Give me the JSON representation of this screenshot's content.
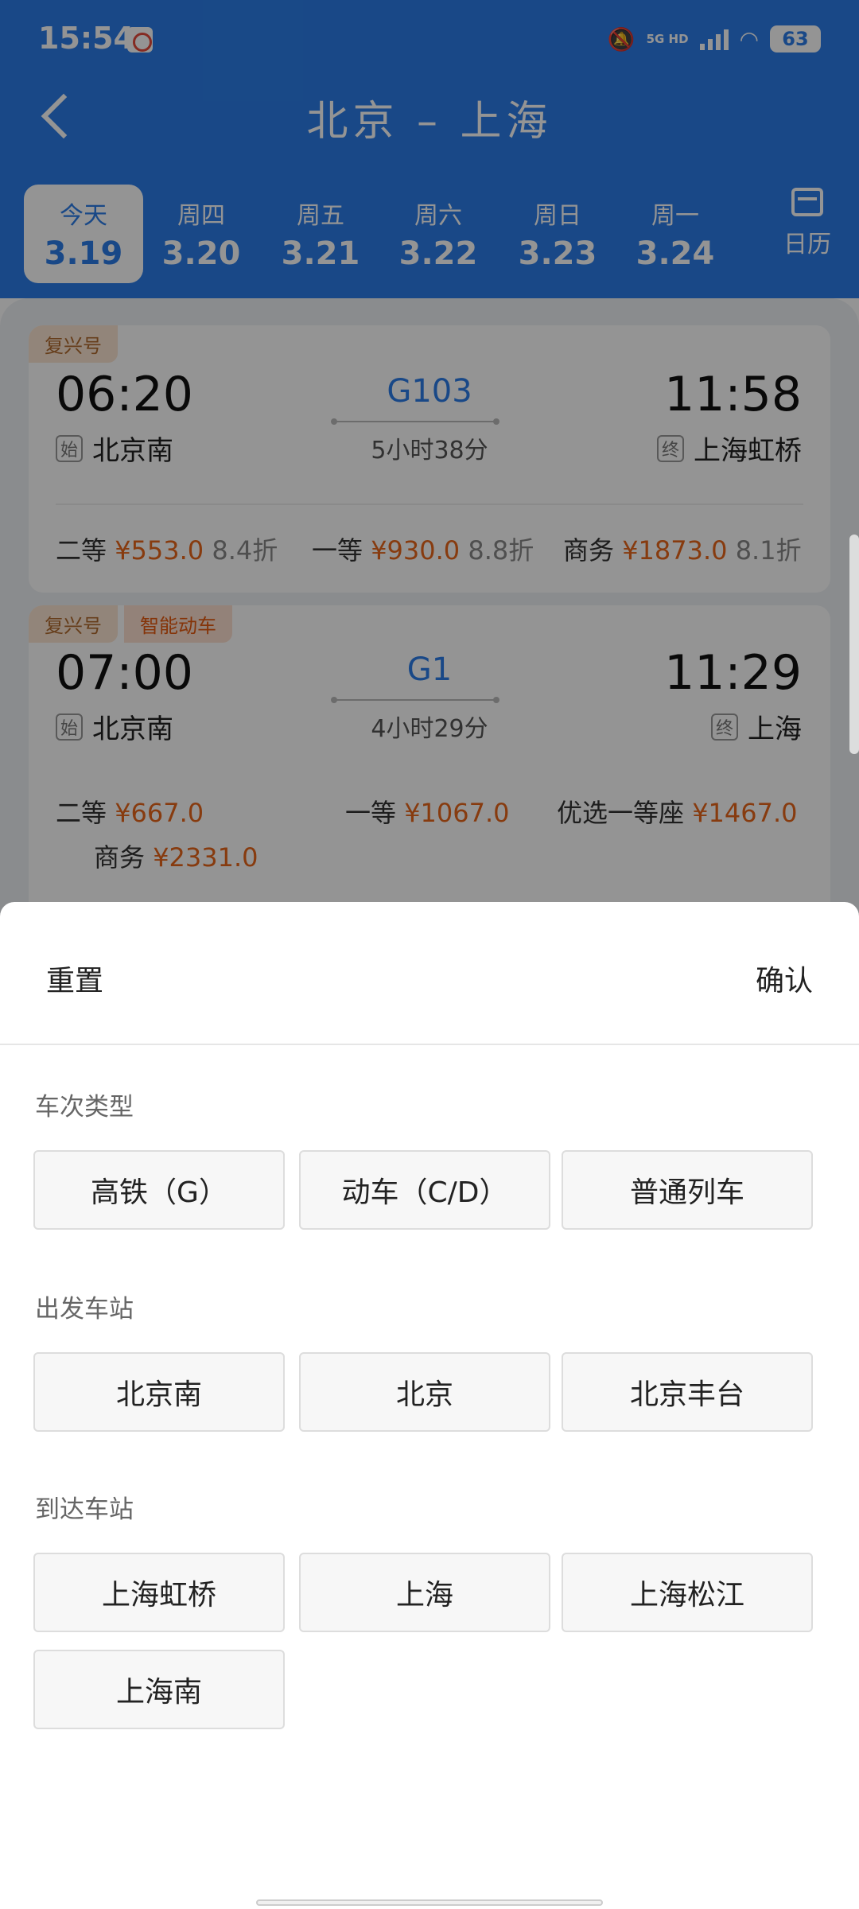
{
  "status_bar": {
    "time": "15:54",
    "network": "5G HD",
    "battery": "63"
  },
  "nav": {
    "title": "北京 – 上海"
  },
  "date_tabs": [
    {
      "weekday": "今天",
      "date": "3.19",
      "active": true
    },
    {
      "weekday": "周四",
      "date": "3.20"
    },
    {
      "weekday": "周五",
      "date": "3.21"
    },
    {
      "weekday": "周六",
      "date": "3.22"
    },
    {
      "weekday": "周日",
      "date": "3.23"
    },
    {
      "weekday": "周一",
      "date": "3.24"
    }
  ],
  "calendar_label": "日历",
  "trains": [
    {
      "tags": [
        "复兴号"
      ],
      "depart_time": "06:20",
      "arrive_time": "11:58",
      "train_no": "G103",
      "duration": "5小时38分",
      "from_badge": "始",
      "from_station": "北京南",
      "to_badge": "终",
      "to_station": "上海虹桥",
      "prices": [
        {
          "seat": "二等",
          "amount": "¥553.0",
          "discount": "8.4折"
        },
        {
          "seat": "一等",
          "amount": "¥930.0",
          "discount": "8.8折"
        },
        {
          "seat": "商务",
          "amount": "¥1873.0",
          "discount": "8.1折"
        }
      ]
    },
    {
      "tags": [
        "复兴号",
        "智能动车"
      ],
      "depart_time": "07:00",
      "arrive_time": "11:29",
      "train_no": "G1",
      "duration": "4小时29分",
      "from_badge": "始",
      "from_station": "北京南",
      "to_badge": "终",
      "to_station": "上海",
      "prices": [
        {
          "seat": "二等",
          "amount": "¥667.0"
        },
        {
          "seat": "一等",
          "amount": "¥1067.0"
        },
        {
          "seat": "优选一等座",
          "amount": "¥1467.0"
        },
        {
          "seat": "商务",
          "amount": "¥2331.0"
        }
      ]
    }
  ],
  "filter_sheet": {
    "reset_label": "重置",
    "confirm_label": "确认",
    "sections": [
      {
        "title": "车次类型",
        "options": [
          "高铁（G）",
          "动车（C/D）",
          "普通列车"
        ]
      },
      {
        "title": "出发车站",
        "options": [
          "北京南",
          "北京",
          "北京丰台"
        ]
      },
      {
        "title": "到达车站",
        "options": [
          "上海虹桥",
          "上海",
          "上海松江",
          "上海南"
        ]
      }
    ]
  }
}
